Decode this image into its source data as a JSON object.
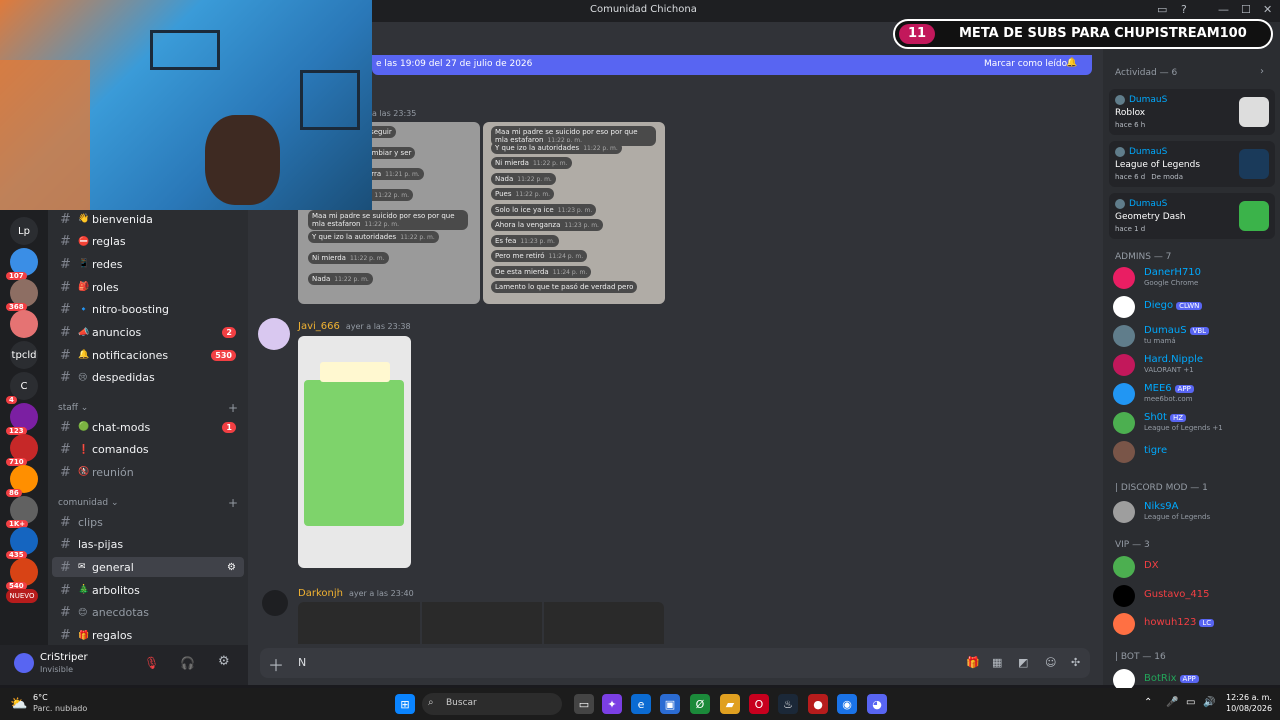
{
  "window": {
    "title": "Comunidad Chichona"
  },
  "meta_overlay": {
    "count": "11",
    "text": "META DE SUBS PARA CHUPISTREAM100"
  },
  "banner": {
    "text": "e las 19:09 del 27 de julio de 2026",
    "action": "Marcar como leído"
  },
  "servers": [
    {
      "label": "Lp",
      "badge": ""
    },
    {
      "label": "",
      "badge": "107"
    },
    {
      "label": "",
      "badge": "368"
    },
    {
      "label": "",
      "badge": ""
    },
    {
      "label": "tpcld",
      "badge": ""
    },
    {
      "label": "C",
      "badge": "4"
    },
    {
      "label": "",
      "badge": "123"
    },
    {
      "label": "",
      "badge": "710"
    },
    {
      "label": "",
      "badge": "86"
    },
    {
      "label": "",
      "badge": "1K+"
    },
    {
      "label": "",
      "badge": "435"
    },
    {
      "label": "",
      "badge": "540"
    },
    {
      "label": "NUEVO",
      "badge": ""
    }
  ],
  "channels": [
    {
      "emoji": "👋",
      "name": "bienvenida",
      "count": ""
    },
    {
      "emoji": "⛔",
      "name": "reglas",
      "count": ""
    },
    {
      "emoji": "📱",
      "name": "redes",
      "count": ""
    },
    {
      "emoji": "🎒",
      "name": "roles",
      "count": ""
    },
    {
      "emoji": "🔹",
      "name": "nitro-boosting",
      "count": ""
    },
    {
      "emoji": "📣",
      "name": "anuncios",
      "count": "2"
    },
    {
      "emoji": "🔔",
      "name": "notificaciones",
      "count": "530"
    },
    {
      "emoji": "😢",
      "name": "despedidas",
      "count": ""
    }
  ],
  "categories": {
    "staff": "staff",
    "comunidad": "comunidad"
  },
  "staff_channels": [
    {
      "emoji": "🟢",
      "name": "chat-mods",
      "count": "1"
    },
    {
      "emoji": "❗",
      "name": "comandos",
      "count": ""
    },
    {
      "emoji": "🚷",
      "name": "reunión",
      "count": ""
    }
  ],
  "community_channels": [
    {
      "emoji": "",
      "name": "clips"
    },
    {
      "emoji": "",
      "name": "las-pijas"
    },
    {
      "emoji": "✉",
      "name": "general"
    },
    {
      "emoji": "🎄",
      "name": "arbolitos"
    },
    {
      "emoji": "😊",
      "name": "anecdotas"
    },
    {
      "emoji": "🎁",
      "name": "regalos"
    }
  ],
  "user": {
    "name": "CriStriper",
    "status": "Invisible"
  },
  "messages": [
    {
      "author": "",
      "time": "a las 23:35"
    },
    {
      "author": "Javi_666",
      "time": "ayer a las 23:38"
    },
    {
      "author": "Darkonjh",
      "time": "ayer a las 23:40"
    }
  ],
  "chat_bubbles_left": [
    {
      "text": "y que en vez de seguir",
      "time": ""
    },
    {
      "text": "amino decidió cambiar y ser",
      "time": ""
    },
    {
      "text": "rsona maldita perra",
      "time": "11:21 p. m."
    },
    {
      "text": "Te digo una cosa",
      "time": "11:22 p. m."
    },
    {
      "text": "Maa mi padre se suicido por eso por que mla estafaron",
      "time": "11:22 p. m."
    },
    {
      "text": "Y que izo la autoridades",
      "time": "11:22 p. m."
    },
    {
      "text": "Ni mierda",
      "time": "11:22 p. m."
    },
    {
      "text": "Nada",
      "time": "11:22 p. m."
    }
  ],
  "chat_bubbles_right": [
    {
      "text": "Maa mi padre se suicido por eso por que mla estafaron",
      "time": "11:22 p. m."
    },
    {
      "text": "Y que izo la autoridades",
      "time": "11:22 p. m."
    },
    {
      "text": "Ni mierda",
      "time": "11:22 p. m."
    },
    {
      "text": "Nada",
      "time": "11:22 p. m."
    },
    {
      "text": "Pues",
      "time": "11:22 p. m."
    },
    {
      "text": "Solo lo ice ya ice",
      "time": "11:23 p. m."
    },
    {
      "text": "Ahora la venganza",
      "time": "11:23 p. m."
    },
    {
      "text": "Es fea",
      "time": "11:23 p. m."
    },
    {
      "text": "Pero me retiró",
      "time": "11:24 p. m."
    },
    {
      "text": "De esta mierda",
      "time": "11:24 p. m."
    },
    {
      "text": "Lamento lo que te pasó de verdad pero",
      "time": ""
    }
  ],
  "composer": {
    "text": "N"
  },
  "activity": {
    "header": "Actividad — 6"
  },
  "activities": [
    {
      "user": "DumauS",
      "game": "Roblox",
      "time": "hace 6 h",
      "extra": ""
    },
    {
      "user": "DumauS",
      "game": "League of Legends",
      "time": "hace 6 d",
      "extra": "De moda"
    },
    {
      "user": "DumauS",
      "game": "Geometry Dash",
      "time": "hace 1 d",
      "extra": ""
    }
  ],
  "groups": {
    "admins": "ADMINS — 7",
    "mods": "| DISCORD MOD — 1",
    "vip": "VIP — 3",
    "bot": "| BOT — 16"
  },
  "admins": [
    {
      "name": "DanerH710",
      "sub": "Google Chrome",
      "tag": "",
      "color": "#00a8fc",
      "av": "#e91e63"
    },
    {
      "name": "Diego",
      "sub": "",
      "tag": "CLWN",
      "color": "#00a8fc",
      "av": "#ffffff"
    },
    {
      "name": "DumauS",
      "sub": "tu mamá",
      "tag": "VBL",
      "color": "#00a8fc",
      "av": "#607d8b"
    },
    {
      "name": "Hard.Nipple",
      "sub": "VALORANT +1",
      "tag": "",
      "color": "#00a8fc",
      "av": "#c2185b"
    },
    {
      "name": "MEE6",
      "sub": "mee6bot.com",
      "tag": "APP",
      "color": "#00a8fc",
      "av": "#2196f3"
    },
    {
      "name": "Sh0t",
      "sub": "League of Legends +1",
      "tag": "HZ",
      "color": "#00a8fc",
      "av": "#4caf50"
    },
    {
      "name": "tigre",
      "sub": "",
      "tag": "",
      "color": "#00a8fc",
      "av": "#795548"
    }
  ],
  "mods": [
    {
      "name": "Niks9A",
      "sub": "League of Legends",
      "tag": "",
      "color": "#00a8fc",
      "av": "#9e9e9e"
    }
  ],
  "vips": [
    {
      "name": "DX",
      "sub": "",
      "tag": "",
      "color": "#f23f43",
      "av": "#4caf50"
    },
    {
      "name": "Gustavo_415",
      "sub": "",
      "tag": "",
      "color": "#f23f43",
      "av": "#000000"
    },
    {
      "name": "howuh123",
      "sub": "",
      "tag": "LC",
      "color": "#f23f43",
      "av": "#ff7043"
    }
  ],
  "bots": [
    {
      "name": "BotRix",
      "sub": "",
      "tag": "APP",
      "color": "#23a55a",
      "av": "#ffffff"
    }
  ],
  "taskbar": {
    "weather_temp": "6°C",
    "weather_desc": "Parc. nublado",
    "search": "Buscar",
    "time": "12:26 a. m.",
    "date": "10/08/2026"
  }
}
